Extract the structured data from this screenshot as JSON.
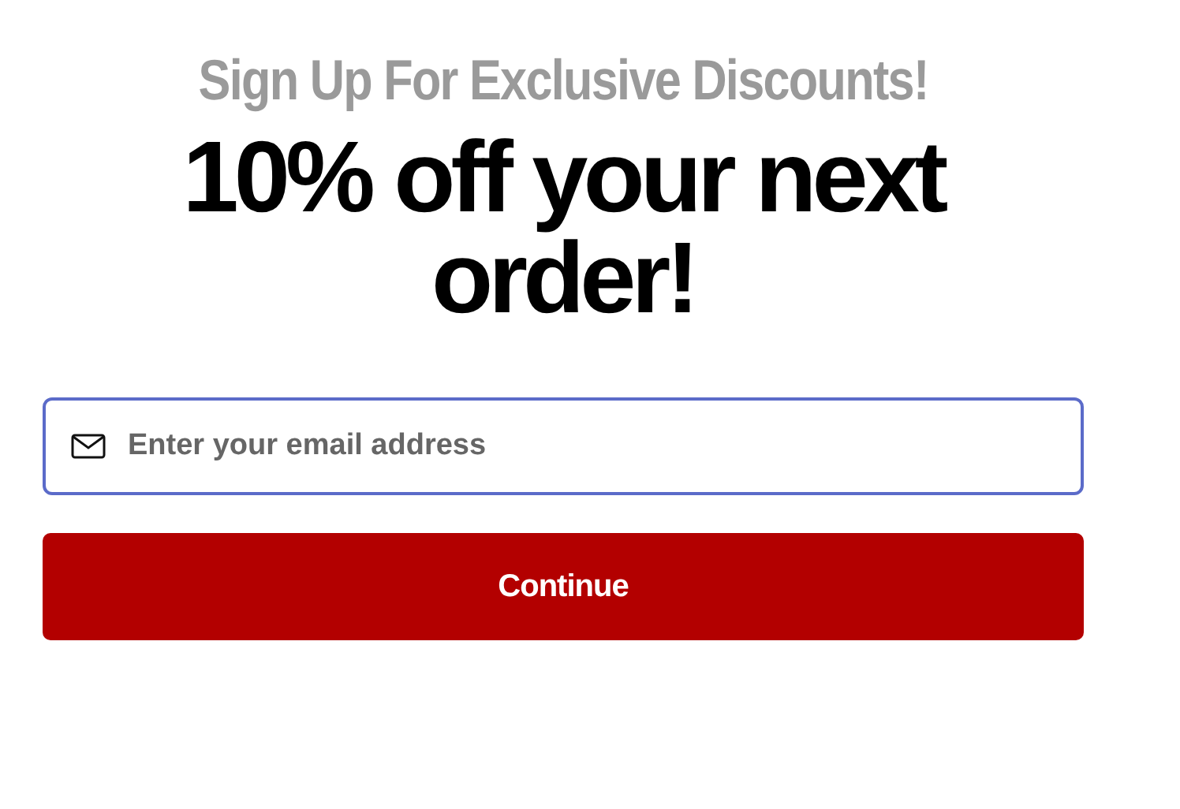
{
  "subtitle": "Sign Up For Exclusive Discounts!",
  "headline": "10% off your next order!",
  "email_field": {
    "placeholder": "Enter your email address",
    "focused": true
  },
  "buttons": [
    "Continue"
  ]
}
